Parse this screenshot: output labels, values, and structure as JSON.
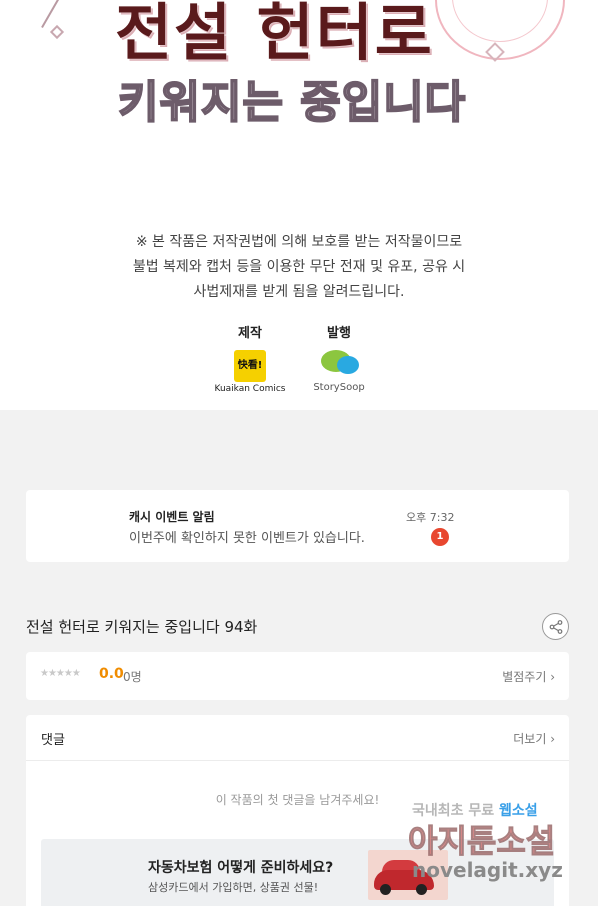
{
  "comic": {
    "title_line1": "전설 헌터로",
    "title_line2": "키워지는 중입니다",
    "notice_lines": [
      "※ 본 작품은 저작권법에 의해 보호를 받는 저작물이므로",
      "불법 복제와 캡처 등을 이용한 무단 전재 및 유포, 공유 시",
      "사법제재를 받게 됨을 알려드립니다."
    ],
    "production_label": "제작",
    "production_logo_text": "快看!",
    "production_name": "Kuaikan Comics",
    "publisher_label": "발행",
    "publisher_name": "StorySoop"
  },
  "notification": {
    "title": "캐시 이벤트 알림",
    "text": "이번주에 확인하지 못한 이벤트가 있습니다.",
    "time": "오후 7:32",
    "badge": "1"
  },
  "episode": {
    "title": "전설 헌터로 키워지는 중입니다 94화"
  },
  "rating": {
    "stars": "★★★★★",
    "score": "0.0",
    "raters": "0명",
    "rate_link": "별점주기 ›"
  },
  "comments": {
    "header": "댓글",
    "more": "더보기 ›",
    "empty": "이 작품의 첫 댓글을 남겨주세요!"
  },
  "ad": {
    "title": "자동차보험 어떻게 준비하세요?",
    "subtitle": "삼성카드에서 가입하면, 상품권 선물!"
  },
  "watermark": {
    "line1a": "국내최초 무료",
    "line1b": "웹소설",
    "line2": "아지툰소설",
    "line3": "novelagit.xyz"
  },
  "colors": {
    "accent_orange": "#f08c00",
    "badge_red": "#e8472f",
    "kuaikan_yellow": "#f5d000"
  }
}
